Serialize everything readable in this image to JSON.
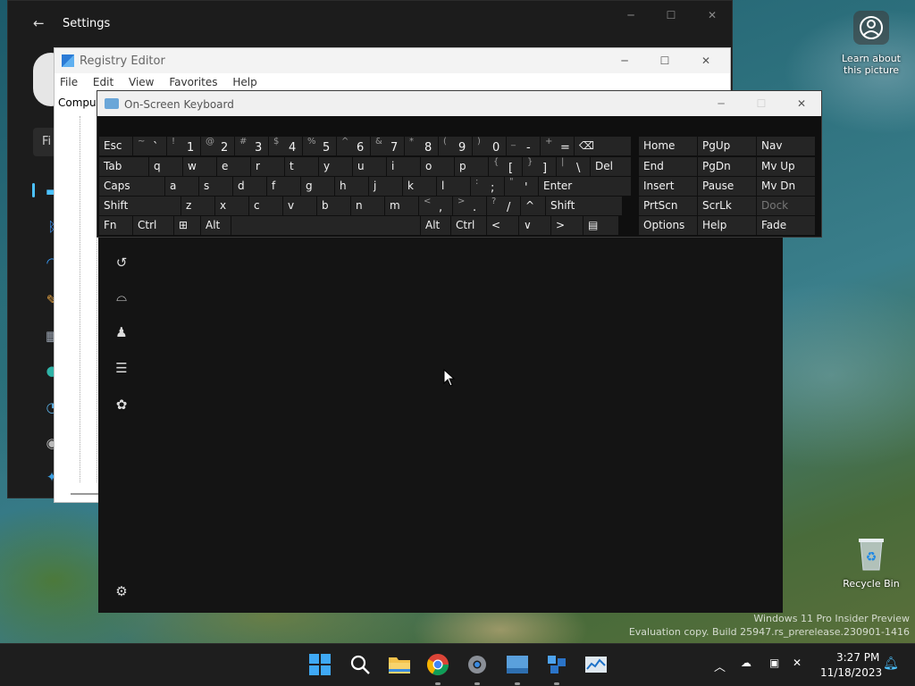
{
  "settings": {
    "title": "Settings",
    "find_fragment": "Fi"
  },
  "regedit": {
    "title": "Registry Editor",
    "menu": [
      "File",
      "Edit",
      "View",
      "Favorites",
      "Help"
    ],
    "tree_label": "Comput"
  },
  "osk": {
    "title": "On-Screen Keyboard",
    "rows": [
      [
        {
          "m": "Esc",
          "w": 38
        },
        {
          "s": "~",
          "m": "`",
          "w": 38
        },
        {
          "s": "!",
          "m": "1",
          "w": 38
        },
        {
          "s": "@",
          "m": "2",
          "w": 38
        },
        {
          "s": "#",
          "m": "3",
          "w": 38
        },
        {
          "s": "$",
          "m": "4",
          "w": 38
        },
        {
          "s": "%",
          "m": "5",
          "w": 38
        },
        {
          "s": "^",
          "m": "6",
          "w": 38
        },
        {
          "s": "&",
          "m": "7",
          "w": 38
        },
        {
          "s": "*",
          "m": "8",
          "w": 38
        },
        {
          "s": "(",
          "m": "9",
          "w": 38
        },
        {
          "s": ")",
          "m": "0",
          "w": 38
        },
        {
          "s": "_",
          "m": "-",
          "w": 38
        },
        {
          "s": "+",
          "m": "=",
          "w": 38
        },
        {
          "m": "⌫",
          "w": 64
        }
      ],
      [
        {
          "m": "Tab",
          "w": 56
        },
        {
          "m": "q",
          "w": 38
        },
        {
          "m": "w",
          "w": 38
        },
        {
          "m": "e",
          "w": 38
        },
        {
          "m": "r",
          "w": 38
        },
        {
          "m": "t",
          "w": 38
        },
        {
          "m": "y",
          "w": 38
        },
        {
          "m": "u",
          "w": 38
        },
        {
          "m": "i",
          "w": 38
        },
        {
          "m": "o",
          "w": 38
        },
        {
          "m": "p",
          "w": 38
        },
        {
          "s": "{",
          "m": "[",
          "w": 38
        },
        {
          "s": "}",
          "m": "]",
          "w": 38
        },
        {
          "s": "|",
          "m": "\\",
          "w": 38
        },
        {
          "m": "Del",
          "w": 46
        }
      ],
      [
        {
          "m": "Caps",
          "w": 74
        },
        {
          "m": "a",
          "w": 38
        },
        {
          "m": "s",
          "w": 38
        },
        {
          "m": "d",
          "w": 38
        },
        {
          "m": "f",
          "w": 38
        },
        {
          "m": "g",
          "w": 38
        },
        {
          "m": "h",
          "w": 38
        },
        {
          "m": "j",
          "w": 38
        },
        {
          "m": "k",
          "w": 38
        },
        {
          "m": "l",
          "w": 38
        },
        {
          "s": ":",
          "m": ";",
          "w": 38
        },
        {
          "s": "\"",
          "m": "'",
          "w": 38
        },
        {
          "m": "Enter",
          "w": 104
        }
      ],
      [
        {
          "m": "Shift",
          "w": 92
        },
        {
          "m": "z",
          "w": 38
        },
        {
          "m": "x",
          "w": 38
        },
        {
          "m": "c",
          "w": 38
        },
        {
          "m": "v",
          "w": 38
        },
        {
          "m": "b",
          "w": 38
        },
        {
          "m": "n",
          "w": 38
        },
        {
          "m": "m",
          "w": 38
        },
        {
          "s": "<",
          "m": ",",
          "w": 38
        },
        {
          "s": ">",
          "m": ".",
          "w": 38
        },
        {
          "s": "?",
          "m": "/",
          "w": 38
        },
        {
          "m": "^",
          "w": 28
        },
        {
          "m": "Shift",
          "w": 86
        }
      ],
      [
        {
          "m": "Fn",
          "w": 38
        },
        {
          "m": "Ctrl",
          "w": 46
        },
        {
          "m": "⊞",
          "w": 30
        },
        {
          "m": "Alt",
          "w": 34
        },
        {
          "m": "",
          "w": 212
        },
        {
          "m": "Alt",
          "w": 34
        },
        {
          "m": "Ctrl",
          "w": 40
        },
        {
          "m": "<",
          "w": 36
        },
        {
          "m": "∨",
          "w": 36
        },
        {
          "m": ">",
          "w": 36
        },
        {
          "m": "▤",
          "w": 40
        }
      ]
    ],
    "right": [
      [
        {
          "m": "Home",
          "w": 66
        },
        {
          "m": "PgUp",
          "w": 66
        },
        {
          "m": "Nav",
          "w": 66
        }
      ],
      [
        {
          "m": "End",
          "w": 66
        },
        {
          "m": "PgDn",
          "w": 66
        },
        {
          "m": "Mv Up",
          "w": 66
        }
      ],
      [
        {
          "m": "Insert",
          "w": 66
        },
        {
          "m": "Pause",
          "w": 66
        },
        {
          "m": "Mv Dn",
          "w": 66
        }
      ],
      [
        {
          "m": "PrtScn",
          "w": 66
        },
        {
          "m": "ScrLk",
          "w": 66
        },
        {
          "m": "Dock",
          "w": 66,
          "dim": true
        }
      ],
      [
        {
          "m": "Options",
          "w": 66
        },
        {
          "m": "Help",
          "w": 66
        },
        {
          "m": "Fade",
          "w": 66
        }
      ]
    ]
  },
  "desktop": {
    "learn_label": "Learn about this picture",
    "recycle_label": "Recycle Bin",
    "watermark_line1": "Windows 11 Pro Insider Preview",
    "watermark_line2": "Evaluation copy. Build 25947.rs_prerelease.230901-1416"
  },
  "taskbar": {
    "time": "3:27 PM",
    "date": "11/18/2023"
  },
  "colors": {
    "taskbar_bg": "#1e1e1e",
    "accent": "#0078d4"
  }
}
